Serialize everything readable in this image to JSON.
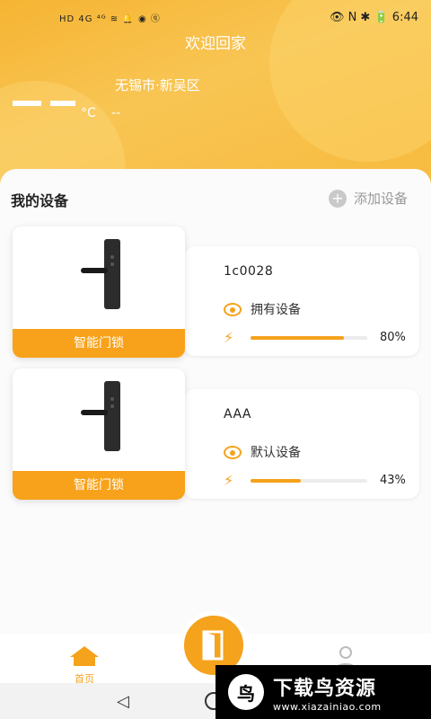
{
  "status_bar": {
    "left_icons": "HD 4G ⁴ᴳ ≋ 🔔 ◉ ⓠ",
    "right_icons": "👁 N ✱ 🔋",
    "time": "6:44"
  },
  "header": {
    "welcome": "欢迎回家",
    "location": "无锡市·新吴区",
    "temp_unit": "°C",
    "temp_extra": "--"
  },
  "devices_section": {
    "title": "我的设备",
    "add_label": "添加设备"
  },
  "devices": [
    {
      "type": "智能门锁",
      "name": "1c0028",
      "status": "拥有设备",
      "battery": 0.8,
      "battery_text": "80%"
    },
    {
      "type": "智能门锁",
      "name": "AAA",
      "status": "默认设备",
      "battery": 0.43,
      "battery_text": "43%"
    }
  ],
  "bottom_nav": {
    "home_label": "首页"
  },
  "watermark": {
    "title": "下载鸟资源",
    "url": "www.xiazainiao.com"
  },
  "colors": {
    "accent": "#f5a21c",
    "header": "#f8c553"
  }
}
